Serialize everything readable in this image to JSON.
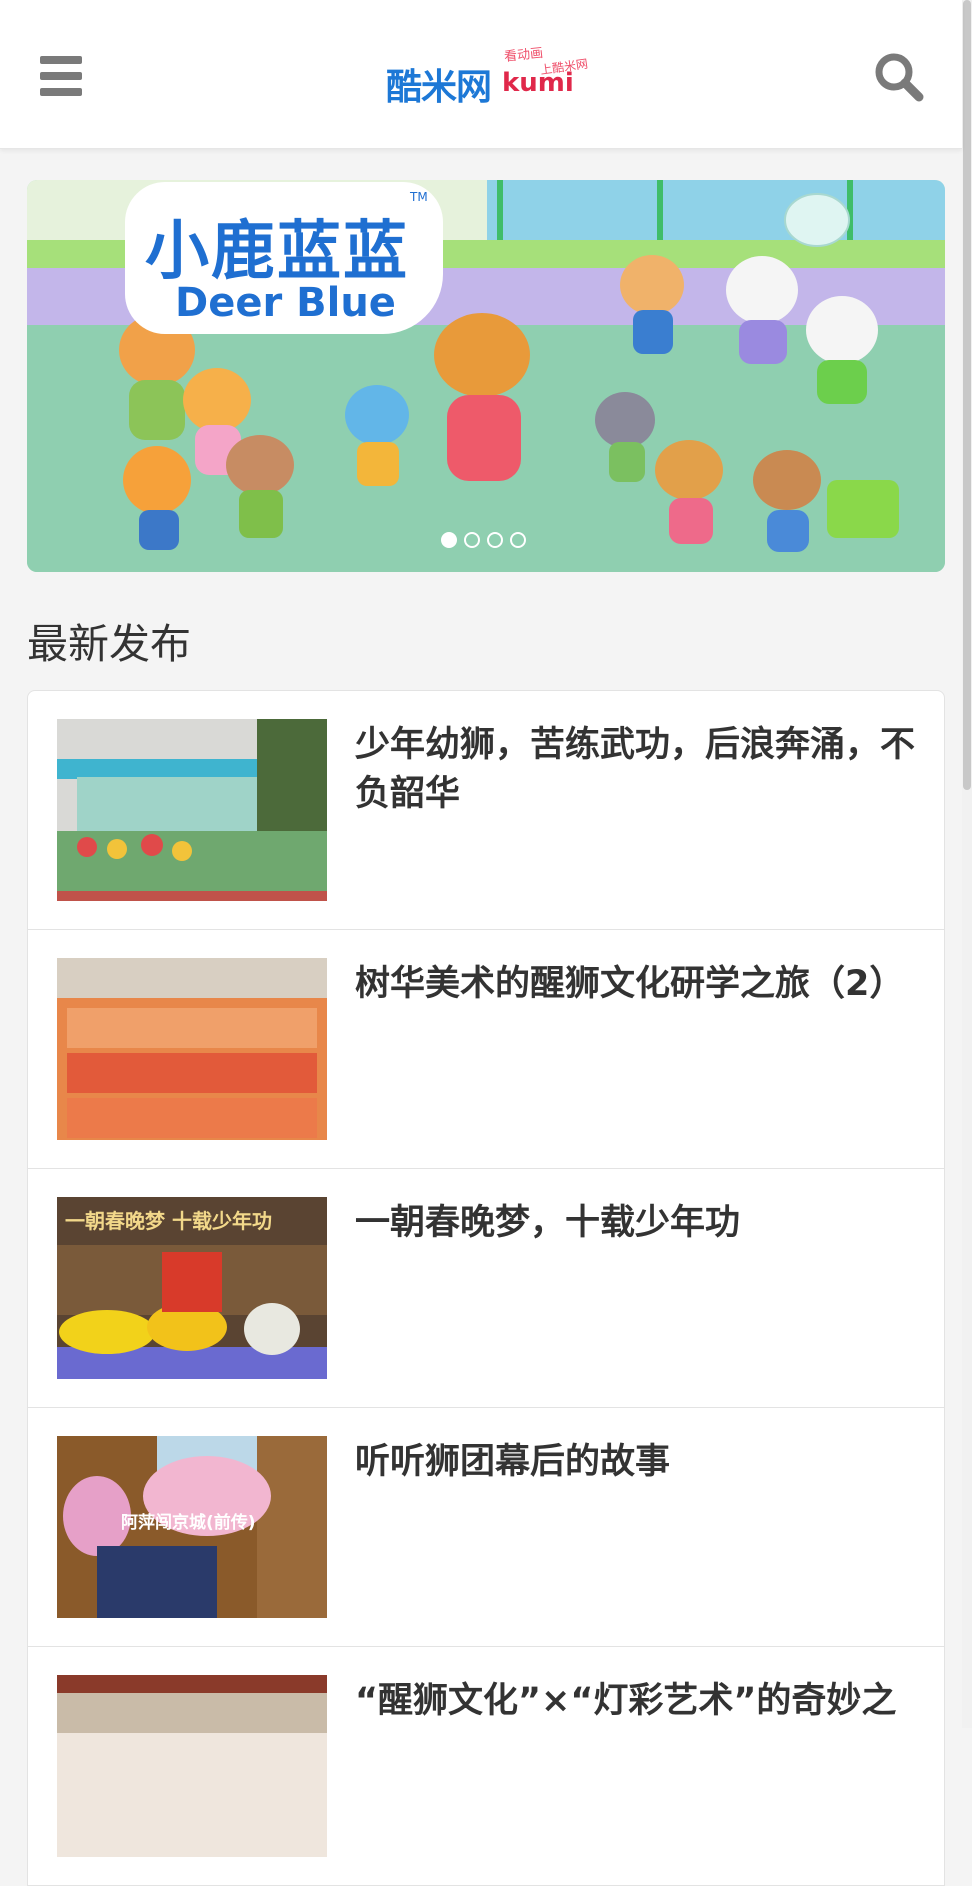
{
  "header": {
    "logo_text": "酷米网",
    "logo_kumi": "kumi",
    "logo_slogan_1": "看动画",
    "logo_slogan_2": "上酷米网"
  },
  "banner": {
    "brand_cn": "小鹿蓝蓝",
    "brand_en": "Deer Blue",
    "brand_tm": "TM",
    "slides_total": 4,
    "active_slide": 1
  },
  "section": {
    "title": "最新发布"
  },
  "articles": [
    {
      "title": "少年幼狮，苦练武功，后浪奔涌，不负韶华",
      "thumb_caption": ""
    },
    {
      "title": "树华美术的醒狮文化研学之旅（2）",
      "thumb_caption": ""
    },
    {
      "title": "一朝春晚梦，十载少年功",
      "thumb_caption": "一朝春晚梦 十载少年功"
    },
    {
      "title": "听听狮团幕后的故事",
      "thumb_caption": "阿萍闯京城(前传)"
    },
    {
      "title": "“醒狮文化”×“灯彩艺术”的奇妙之",
      "thumb_caption": ""
    }
  ],
  "colors": {
    "brand_blue": "#1f6fd1",
    "icon_gray": "#7a7a7a",
    "banner_floor": "#8fcfb0"
  },
  "icons": {
    "menu": "hamburger-icon",
    "search": "search-icon"
  }
}
